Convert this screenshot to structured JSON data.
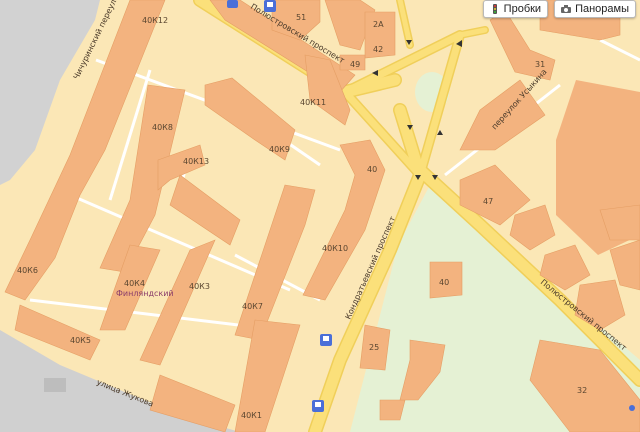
{
  "streets": {
    "poliustrovsky_top": "Полюстровский проспект",
    "poliustrovsky_bottom": "Полюстровский проспект",
    "kondratyevsky": "Кондратьевский проспект",
    "chichurinsky": "Чичуринский переулок",
    "usykina": "переулок Усыкина",
    "zhukova": "улица Жукова"
  },
  "district": "Финляндский",
  "buildings": {
    "b51": "51",
    "b2a": "2А",
    "b42": "42",
    "b49": "49",
    "b31": "31",
    "b40k12": "40К12",
    "b40k8": "40К8",
    "b40k13": "40К13",
    "b40k9": "40К9",
    "b40k11": "40К11",
    "b40": "40",
    "b40k6": "40К6",
    "b40k4": "40К4",
    "b40k3": "40К3",
    "b40k7": "40К7",
    "b40k10": "40К10",
    "b40k5": "40К5",
    "b40k1": "40К1",
    "b47": "47",
    "b40park": "40",
    "b25": "25",
    "b32": "32"
  },
  "toolbar": {
    "traffic_label": "Пробки",
    "traffic_icon": "traffic-light-icon",
    "panoramas_label": "Панорамы",
    "panoramas_icon": "camera-icon"
  },
  "colors": {
    "background": "#fbe7b6",
    "building": "#f3b37f",
    "road": "#fbe07a",
    "park": "#e6f1d5",
    "industrial": "#cfcfcf",
    "bus_stop": "#4a6fd8"
  }
}
